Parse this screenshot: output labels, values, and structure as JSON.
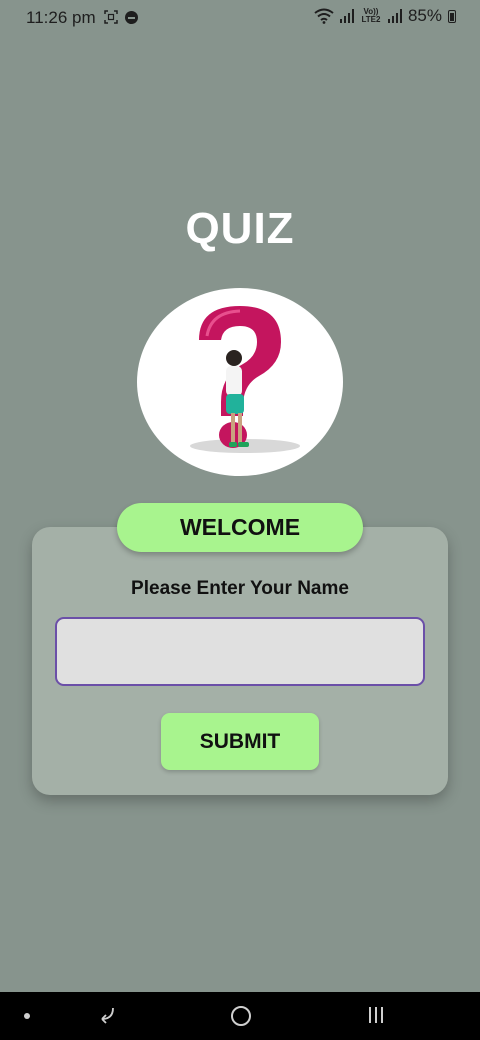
{
  "status_bar": {
    "time": "11:26 pm",
    "volte_label": "Vo)) LTE2",
    "battery": "85%"
  },
  "app": {
    "title": "QUIZ",
    "welcome": "WELCOME",
    "prompt": "Please Enter Your Name",
    "name_input_value": "",
    "submit_label": "SUBMIT"
  },
  "colors": {
    "background": "#87948d",
    "card": "#a4b0a7",
    "accent_green": "#a8f48e",
    "input_border": "#6b4fa8",
    "question_mark": "#c4155e"
  },
  "icons": [
    "screenshot-icon",
    "do-not-disturb-icon",
    "wifi-icon",
    "signal-icon",
    "battery-icon",
    "question-mark-logo",
    "back-icon",
    "home-icon",
    "recents-icon"
  ]
}
